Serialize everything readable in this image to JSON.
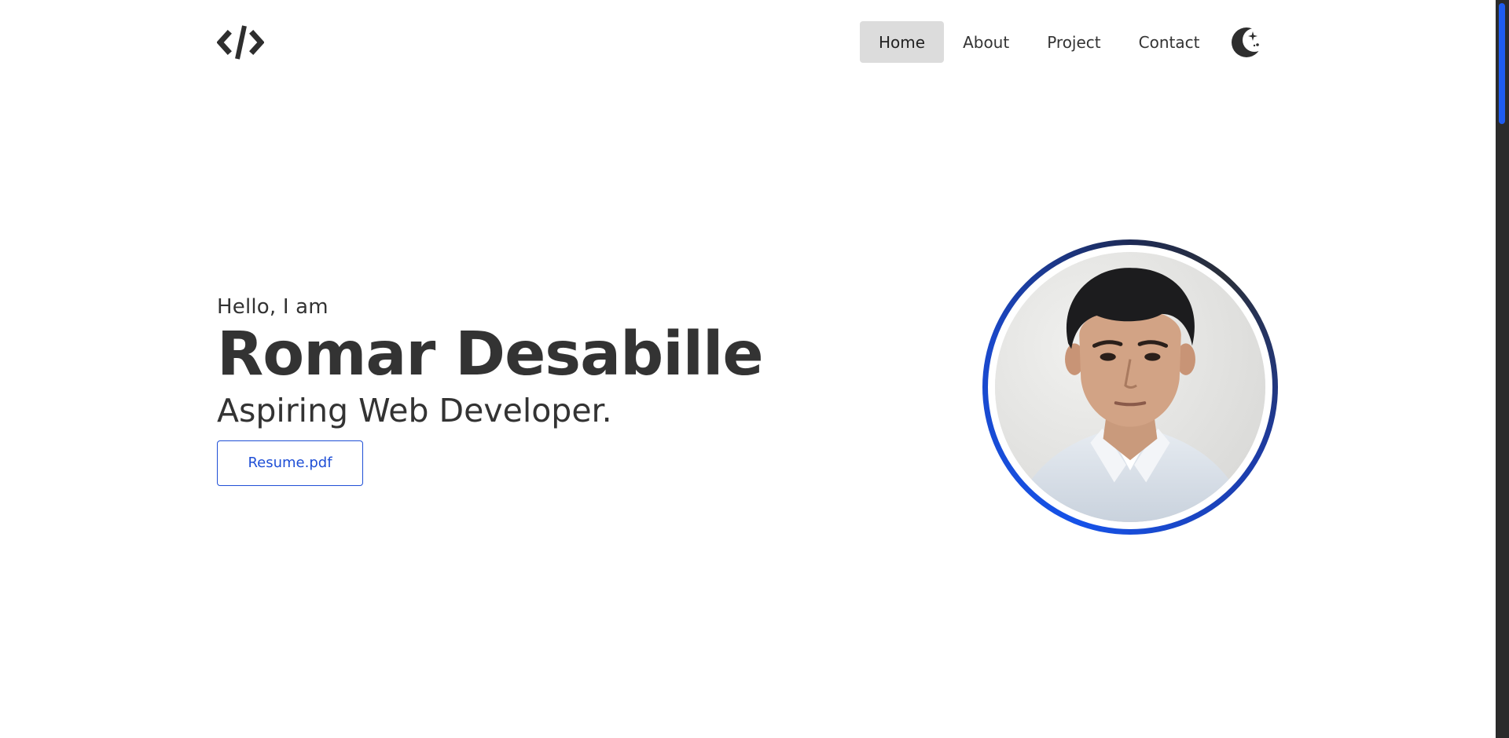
{
  "header": {
    "logo_icon": "code-brackets-icon",
    "nav": [
      {
        "label": "Home",
        "active": true
      },
      {
        "label": "About",
        "active": false
      },
      {
        "label": "Project",
        "active": false
      },
      {
        "label": "Contact",
        "active": false
      }
    ],
    "theme_toggle_icon": "moon-stars-icon"
  },
  "hero": {
    "greeting": "Hello, I am",
    "name": "Romar Desabille",
    "role": "Aspiring Web Developer.",
    "resume_label": "Resume.pdf"
  },
  "profile": {
    "icon": "profile-photo"
  },
  "colors": {
    "accent": "#1f4fd6",
    "text": "#333333",
    "nav_active_bg": "#dcdcdc",
    "scroll_thumb": "#1f5cf0"
  }
}
